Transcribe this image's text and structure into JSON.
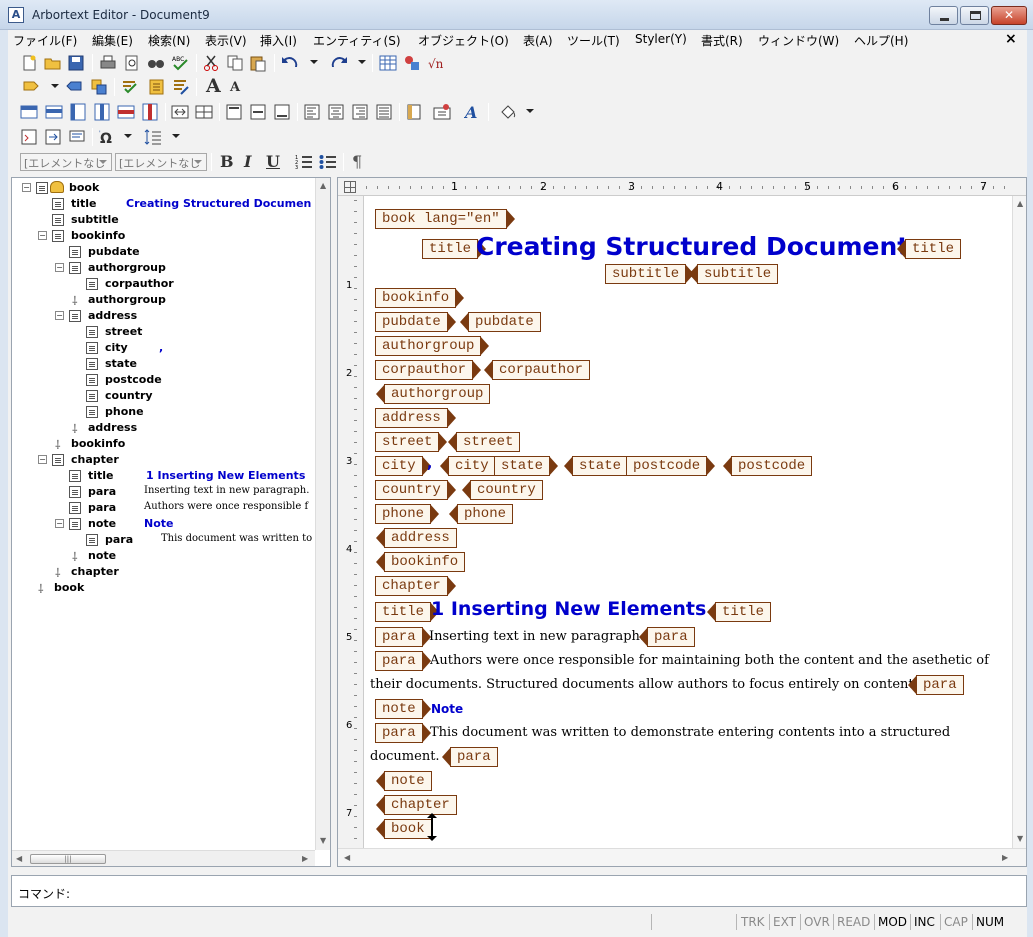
{
  "window": {
    "app_icon": "A",
    "title": "Arbortext Editor - Document9",
    "close_glyph": "✕"
  },
  "menu": {
    "items": [
      "ファイル(F)",
      "編集(E)",
      "検索(N)",
      "表示(V)",
      "挿入(I)",
      "エンティティ(S)",
      "オブジェクト(O)",
      "表(A)",
      "ツール(T)",
      "Styler(Y)",
      "書式(R)",
      "ウィンドウ(W)",
      "ヘルプ(H)"
    ],
    "close_glyph": "×"
  },
  "toolbar": {
    "element_list_1": "[エレメントなし",
    "element_list_2": "[エレメントなし",
    "bold_glyph": "B",
    "italic_glyph": "I",
    "underline_glyph": "U",
    "pilcrow_glyph": "¶",
    "font_up_glyph": "A",
    "font_down_glyph": "A",
    "omega_glyph": "Ω"
  },
  "tree": {
    "rows": [
      {
        "label": "book",
        "toggle": "⊟",
        "icon": "book"
      },
      {
        "label": "title",
        "content": "Creating Structured Documen"
      },
      {
        "label": "subtitle"
      },
      {
        "label": "bookinfo",
        "toggle": "⊟"
      },
      {
        "label": "pubdate"
      },
      {
        "label": "authorgroup",
        "toggle": "⊟"
      },
      {
        "label": "corpauthor"
      },
      {
        "label": "authorgroup",
        "end": true
      },
      {
        "label": "address",
        "toggle": "⊟"
      },
      {
        "label": "street"
      },
      {
        "label": "city",
        "content": ","
      },
      {
        "label": "state"
      },
      {
        "label": "postcode"
      },
      {
        "label": "country"
      },
      {
        "label": "phone"
      },
      {
        "label": "address",
        "end": true
      },
      {
        "label": "bookinfo",
        "end": true
      },
      {
        "label": "chapter",
        "toggle": "⊟"
      },
      {
        "label": "title",
        "content": "1 Inserting New Elements"
      },
      {
        "label": "para",
        "content": "Inserting text in new paragraph."
      },
      {
        "label": "para",
        "content": "Authors were once responsible f"
      },
      {
        "label": "note",
        "toggle": "⊟",
        "content": "Note"
      },
      {
        "label": "para",
        "content": "This document was written to"
      },
      {
        "label": "note",
        "end": true
      },
      {
        "label": "chapter",
        "end": true
      },
      {
        "label": "book",
        "end": true
      }
    ]
  },
  "ruler": {
    "h_numbers": [
      "1",
      "2",
      "3",
      "4",
      "5",
      "6",
      "7"
    ],
    "v_numbers": [
      "1",
      "2",
      "3",
      "4",
      "5",
      "6",
      "7"
    ]
  },
  "doc": {
    "tags": {
      "book_start": "book lang=\"en\"",
      "title": "title",
      "subtitle": "subtitle",
      "bookinfo": "bookinfo",
      "pubdate": "pubdate",
      "authorgroup": "authorgroup",
      "corpauthor": "corpauthor",
      "address": "address",
      "street": "street",
      "city": "city",
      "state": "state",
      "postcode": "postcode",
      "country": "country",
      "phone": "phone",
      "chapter": "chapter",
      "para": "para",
      "note": "note",
      "book": "book"
    },
    "book_title": "Creating Structured Documents",
    "city_text": ",",
    "chapter_title": "1 Inserting New Elements",
    "para1": "Inserting text in new paragraph.",
    "para2_line1": "Authors were once responsible for maintaining both the content and the asethetic of",
    "para2_line2": "their documents. Structured documents allow authors to focus entirely on content.",
    "note_title": "Note",
    "para3_line1": "This document was written to demonstrate entering contents into a structured",
    "para3_line2": "document."
  },
  "command": {
    "label": "コマンド:"
  },
  "status": {
    "items": [
      {
        "text": "TRK",
        "active": false
      },
      {
        "text": "EXT",
        "active": false
      },
      {
        "text": "OVR",
        "active": false
      },
      {
        "text": "READ",
        "active": false
      },
      {
        "text": "MOD",
        "active": true
      },
      {
        "text": "INC",
        "active": true
      },
      {
        "text": "CAP",
        "active": false
      },
      {
        "text": "NUM",
        "active": true
      }
    ]
  }
}
